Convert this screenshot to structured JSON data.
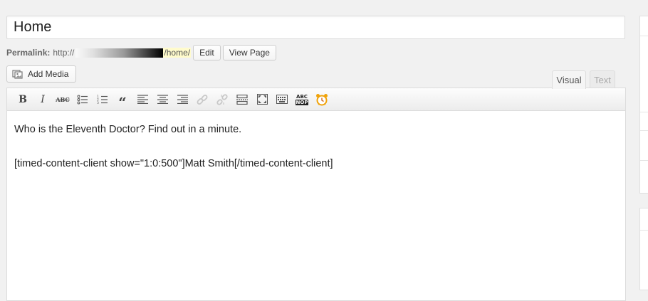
{
  "post": {
    "title": "Home"
  },
  "permalink": {
    "label": "Permalink:",
    "prefix": "http://",
    "slug": "/home/",
    "edit_label": "Edit",
    "view_label": "View Page"
  },
  "media": {
    "add_label": "Add Media"
  },
  "tabs": {
    "visual": "Visual",
    "text": "Text"
  },
  "toolbar": {
    "icons": [
      "bold-icon",
      "italic-icon",
      "strikethrough-icon",
      "bulleted-list-icon",
      "numbered-list-icon",
      "blockquote-icon",
      "align-left-icon",
      "align-center-icon",
      "align-right-icon",
      "insert-link-icon",
      "remove-link-icon",
      "more-tag-icon",
      "fullscreen-icon",
      "toolbar-toggle-icon",
      "spellcheck-icon",
      "timed-content-icon"
    ],
    "bold_glyph": "B",
    "italic_glyph": "I",
    "strike_glyph": "ABC",
    "quote_glyph": "“",
    "spell_top": "ABC",
    "spell_bottom": "NOP"
  },
  "editor": {
    "line1": "Who is the Eleventh Doctor?  Find out in a minute.",
    "line2": "[timed-content-client show=\"1:0:500\"]Matt Smith[/timed-content-client]"
  },
  "colors": {
    "slug_highlight": "#fffbcc",
    "background": "#f1f1f1",
    "clock_orange": "#f0a30a"
  }
}
